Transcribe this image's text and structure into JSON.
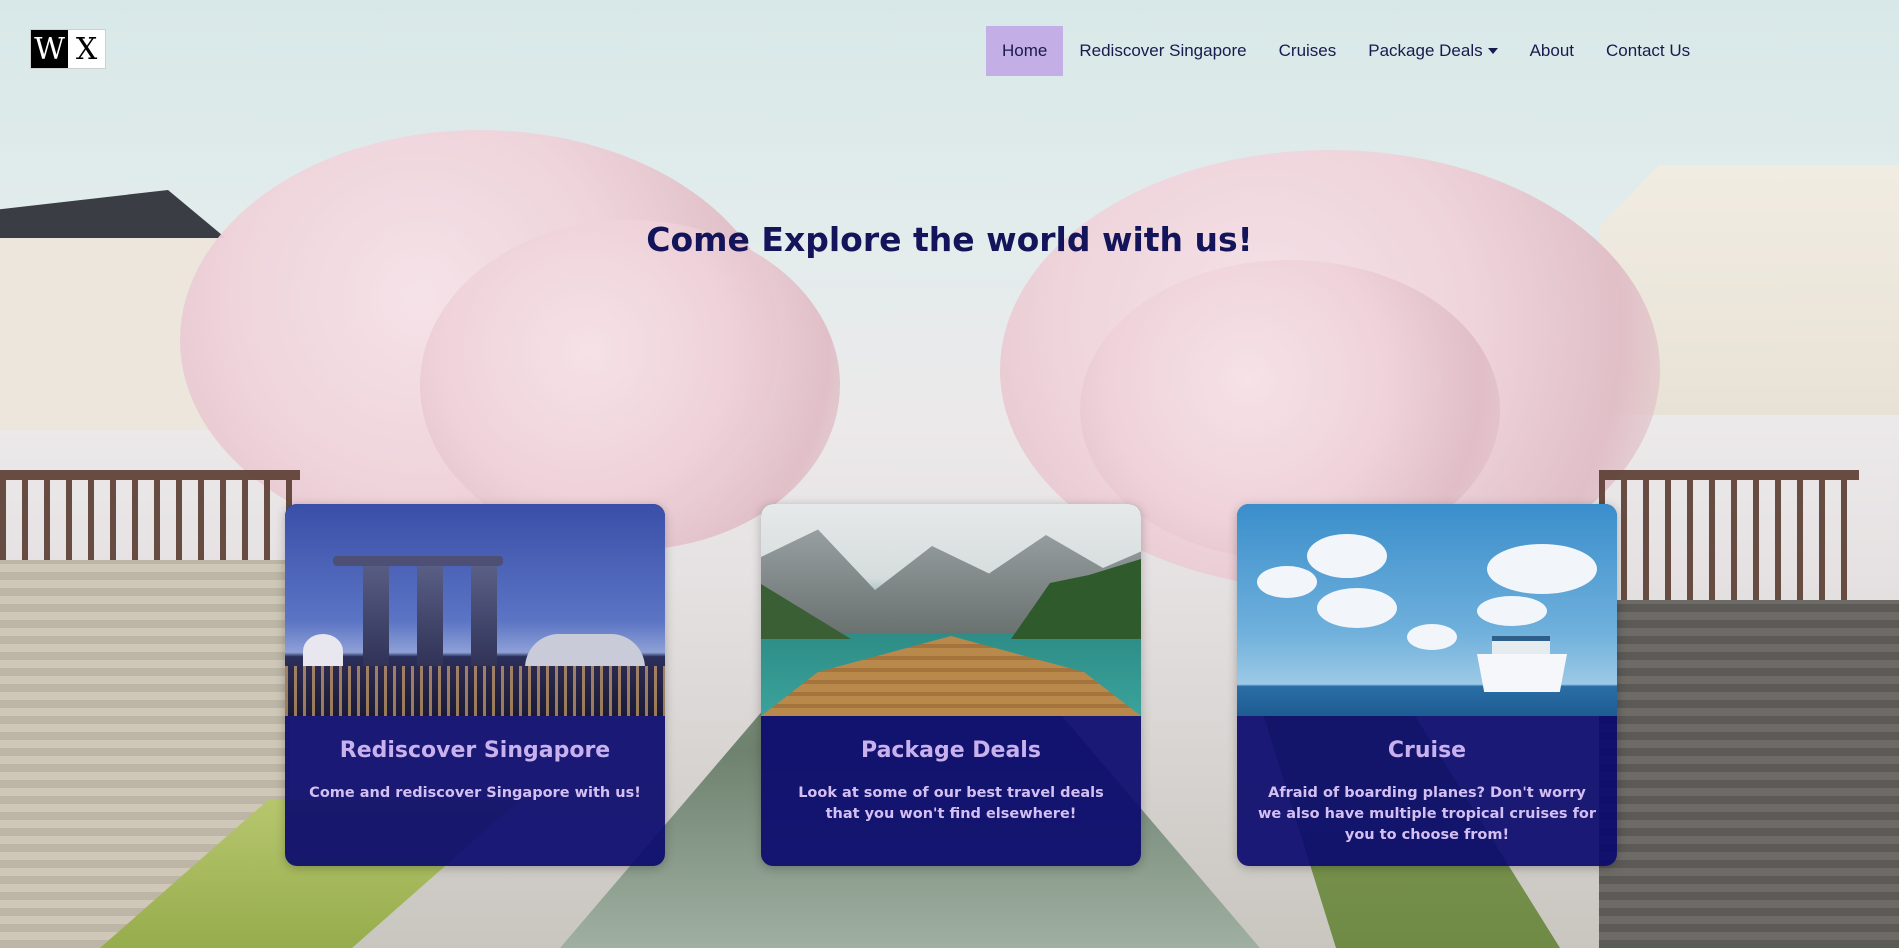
{
  "logo": {
    "left_letter": "W",
    "right_letter": "X"
  },
  "nav": {
    "items": [
      {
        "label": "Home",
        "active": true
      },
      {
        "label": "Rediscover Singapore",
        "active": false
      },
      {
        "label": "Cruises",
        "active": false
      },
      {
        "label": "Package Deals",
        "active": false,
        "has_dropdown": true
      },
      {
        "label": "About",
        "active": false
      },
      {
        "label": "Contact Us",
        "active": false
      }
    ],
    "active_color": "#c4aee6"
  },
  "hero": {
    "title": "Come Explore the world with us!"
  },
  "cards": [
    {
      "title": "Rediscover Singapore",
      "text": "Come and rediscover Singapore with us!",
      "image": "singapore-skyline-image"
    },
    {
      "title": "Package Deals",
      "text": "Look at some of our best travel deals that you won't find elsewhere!",
      "image": "mountain-lake-boat-image"
    },
    {
      "title": "Cruise",
      "text": "Afraid of boarding planes? Don't worry we also have multiple tropical cruises for you to choose from!",
      "image": "cruise-ship-image"
    }
  ],
  "colors": {
    "heading": "#14145a",
    "card_background": "#0a0a6e",
    "card_text": "#c9b1ee"
  },
  "background": "cherry-blossom-canal-image"
}
